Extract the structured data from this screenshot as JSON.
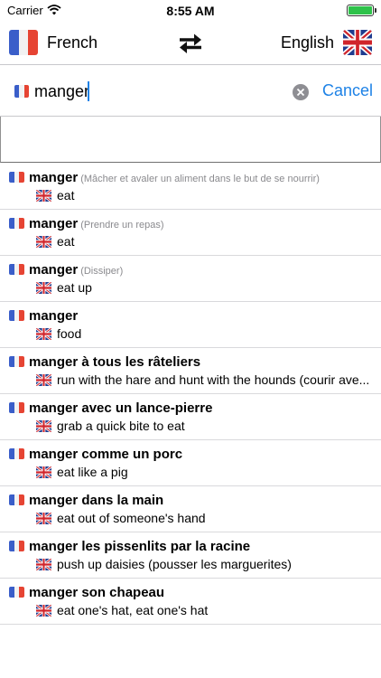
{
  "status": {
    "carrier": "Carrier",
    "time": "8:55 AM",
    "battery_level": 1.0
  },
  "languages": {
    "source": "French",
    "target": "English"
  },
  "search": {
    "value": "manger",
    "cancel_label": "Cancel"
  },
  "colors": {
    "accent": "#1e82e6",
    "battery": "#2ec24a",
    "fr_blue": "#3a5ec9",
    "fr_red": "#e64433",
    "uk_blue": "#1f3c8f",
    "uk_red": "#d0242b"
  },
  "results": [
    {
      "term": "manger",
      "note": "(Mâcher et avaler un aliment dans le but de se nourrir)",
      "translation": "eat"
    },
    {
      "term": "manger",
      "note": "(Prendre un repas)",
      "translation": "eat"
    },
    {
      "term": "manger",
      "note": "(Dissiper)",
      "translation": "eat up"
    },
    {
      "term": "manger",
      "note": "",
      "translation": "food"
    },
    {
      "term": "manger à tous les râteliers",
      "note": "",
      "translation": "run with the hare and hunt with the hounds (courir ave..."
    },
    {
      "term": "manger avec un lance-pierre",
      "note": "",
      "translation": "grab a quick bite to eat"
    },
    {
      "term": "manger comme un porc",
      "note": "",
      "translation": "eat like a pig"
    },
    {
      "term": "manger dans la main",
      "note": "",
      "translation": "eat out of someone's hand"
    },
    {
      "term": "manger les pissenlits par la racine",
      "note": "",
      "translation": "push up daisies (pousser les marguerites)"
    },
    {
      "term": "manger son chapeau",
      "note": "",
      "translation": "eat one's hat, eat one's hat"
    }
  ]
}
